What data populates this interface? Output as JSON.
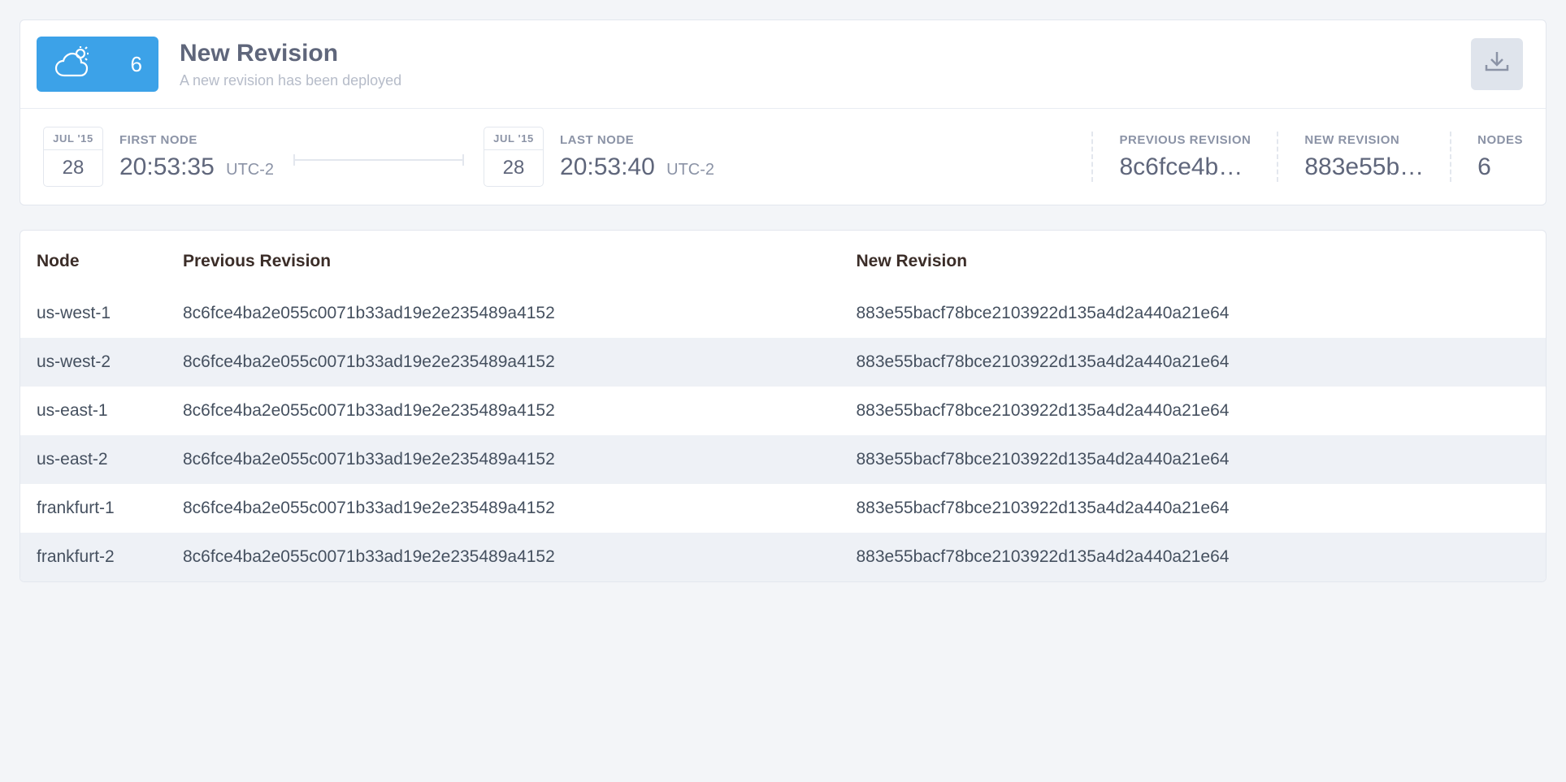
{
  "header": {
    "title": "New Revision",
    "subtitle": "A new revision has been deployed",
    "badge_count": "6"
  },
  "first_node": {
    "month": "JUL '15",
    "day": "28",
    "label": "FIRST NODE",
    "time": "20:53:35",
    "tz": "UTC-2"
  },
  "last_node": {
    "month": "JUL '15",
    "day": "28",
    "label": "LAST NODE",
    "time": "20:53:40",
    "tz": "UTC-2"
  },
  "previous_revision": {
    "label": "PREVIOUS REVISION",
    "value": "8c6fce4b…"
  },
  "new_revision": {
    "label": "NEW REVISION",
    "value": "883e55b…"
  },
  "nodes_stat": {
    "label": "NODES",
    "value": "6"
  },
  "table": {
    "headers": {
      "node": "Node",
      "prev": "Previous Revision",
      "new": "New Revision"
    },
    "rows": [
      {
        "node": "us-west-1",
        "prev": "8c6fce4ba2e055c0071b33ad19e2e235489a4152",
        "new": "883e55bacf78bce2103922d135a4d2a440a21e64"
      },
      {
        "node": "us-west-2",
        "prev": "8c6fce4ba2e055c0071b33ad19e2e235489a4152",
        "new": "883e55bacf78bce2103922d135a4d2a440a21e64"
      },
      {
        "node": "us-east-1",
        "prev": "8c6fce4ba2e055c0071b33ad19e2e235489a4152",
        "new": "883e55bacf78bce2103922d135a4d2a440a21e64"
      },
      {
        "node": "us-east-2",
        "prev": "8c6fce4ba2e055c0071b33ad19e2e235489a4152",
        "new": "883e55bacf78bce2103922d135a4d2a440a21e64"
      },
      {
        "node": "frankfurt-1",
        "prev": "8c6fce4ba2e055c0071b33ad19e2e235489a4152",
        "new": "883e55bacf78bce2103922d135a4d2a440a21e64"
      },
      {
        "node": "frankfurt-2",
        "prev": "8c6fce4ba2e055c0071b33ad19e2e235489a4152",
        "new": "883e55bacf78bce2103922d135a4d2a440a21e64"
      }
    ]
  }
}
